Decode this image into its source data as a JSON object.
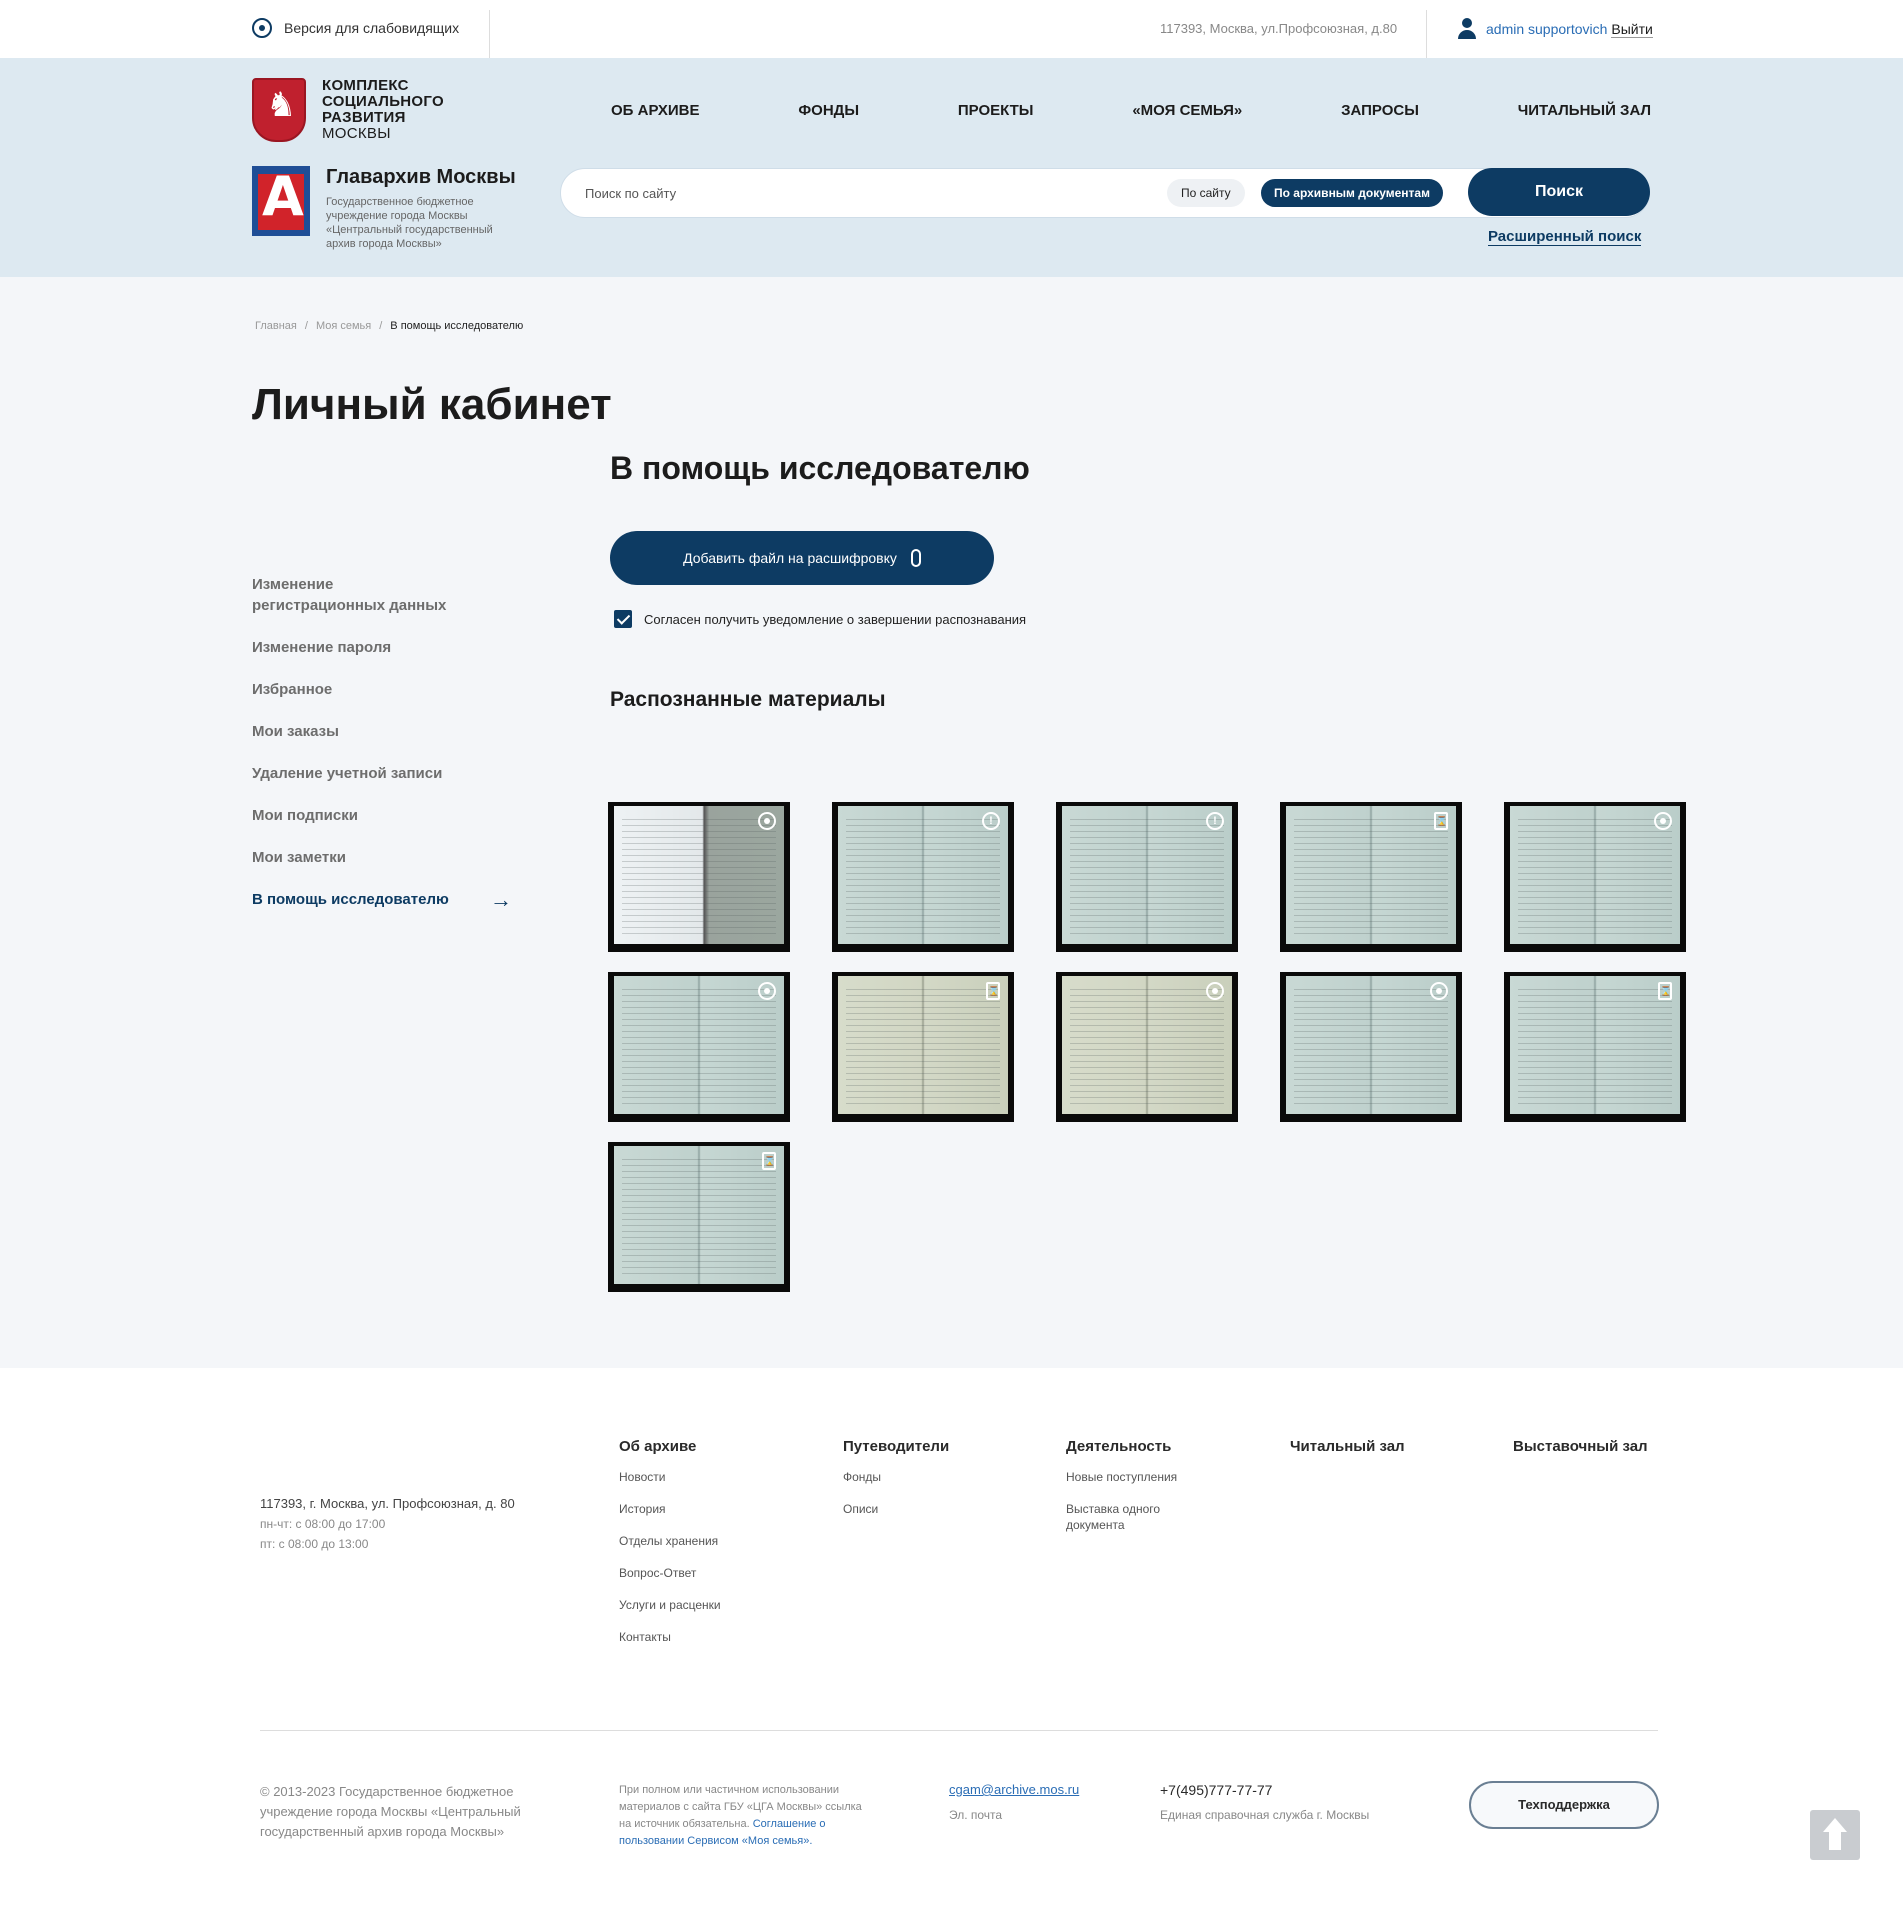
{
  "topbar": {
    "vision_label": "Версия для слабовидящих",
    "address": "117393, Москва, ул.Профсоюзная, д.80",
    "user_name": "admin supportovich",
    "logout": "Выйти"
  },
  "header": {
    "logo1": [
      "КОМПЛЕКС",
      "СОЦИАЛЬНОГО",
      "РАЗВИТИЯ",
      "МОСКВЫ"
    ],
    "nav": [
      "ОБ АРХИВЕ",
      "ФОНДЫ",
      "ПРОЕКТЫ",
      "«МОЯ СЕМЬЯ»",
      "ЗАПРОСЫ",
      "ЧИТАЛЬНЫЙ ЗАЛ"
    ],
    "logo2_name": "Главархив Москвы",
    "logo2_desc": "Государственное бюджетное учреждение города Москвы «Центральный государственный архив города Москвы»",
    "search_placeholder": "Поиск по сайту",
    "chip_site": "По сайту",
    "chip_archive": "По архивным документам",
    "search_button": "Поиск",
    "advanced": "Расширенный поиск"
  },
  "breadcrumb": [
    "Главная",
    "Моя семья",
    "В помощь исследователю"
  ],
  "page_title": "Личный кабинет",
  "section_title": "В помощь исследователю",
  "sidebar": [
    "Изменение регистрационных данных",
    "Изменение пароля",
    "Избранное",
    "Мои заказы",
    "Удаление учетной записи",
    "Мои подписки",
    "Мои заметки",
    "В помощь исследователю"
  ],
  "upload_button": "Добавить файл на расшифровку",
  "consent_label": "Согласен получить уведомление о завершении распознавания",
  "recognized_title": "Распознанные материалы",
  "thumbs": [
    {
      "status": "eye-icon",
      "tone": "white"
    },
    {
      "status": "warning-icon",
      "tone": "blue"
    },
    {
      "status": "warning-icon",
      "tone": "blue"
    },
    {
      "status": "hourglass-icon",
      "tone": "blue"
    },
    {
      "status": "eye-icon",
      "tone": "blue"
    },
    {
      "status": "eye-icon",
      "tone": "blue"
    },
    {
      "status": "hourglass-icon",
      "tone": "beige"
    },
    {
      "status": "eye-icon",
      "tone": "beige"
    },
    {
      "status": "eye-icon",
      "tone": "blue"
    },
    {
      "status": "hourglass-icon",
      "tone": "blue"
    },
    {
      "status": "hourglass-icon",
      "tone": "blue"
    }
  ],
  "footer": {
    "address": "117393, г. Москва, ул. Профсоюзная, д. 80",
    "hours1": "пн-чт: с 08:00 до 17:00",
    "hours2": "пт: с 08:00 до 13:00",
    "columns": [
      {
        "title": "Об архиве",
        "links": [
          "Новости",
          "История",
          "Отделы хранения",
          "Вопрос-Ответ",
          "Услуги и расценки",
          "Контакты"
        ]
      },
      {
        "title": "Путеводители",
        "links": [
          "Фонды",
          "Описи"
        ]
      },
      {
        "title": "Деятельность",
        "links": [
          "Новые поступления",
          "Выставка одного документа"
        ]
      },
      {
        "title": "Читальный зал",
        "links": []
      },
      {
        "title": "Выставочный зал",
        "links": []
      }
    ],
    "copyright": "© 2013-2023 Государственное бюджетное учреждение города Москвы «Центральный государственный архив города Москвы»",
    "note": "При полном или частичном использовании материалов с сайта ГБУ «ЦГА Москвы» ссылка на источник обязательна.",
    "note_link": "Соглашение о пользовании Сервисом «Моя семья».",
    "email": "cgam@archive.mos.ru",
    "email_label": "Эл. почта",
    "phone": "+7(495)777-77-77",
    "phone_label": "Единая справочная служба г. Москвы",
    "support": "Техподдержка"
  }
}
